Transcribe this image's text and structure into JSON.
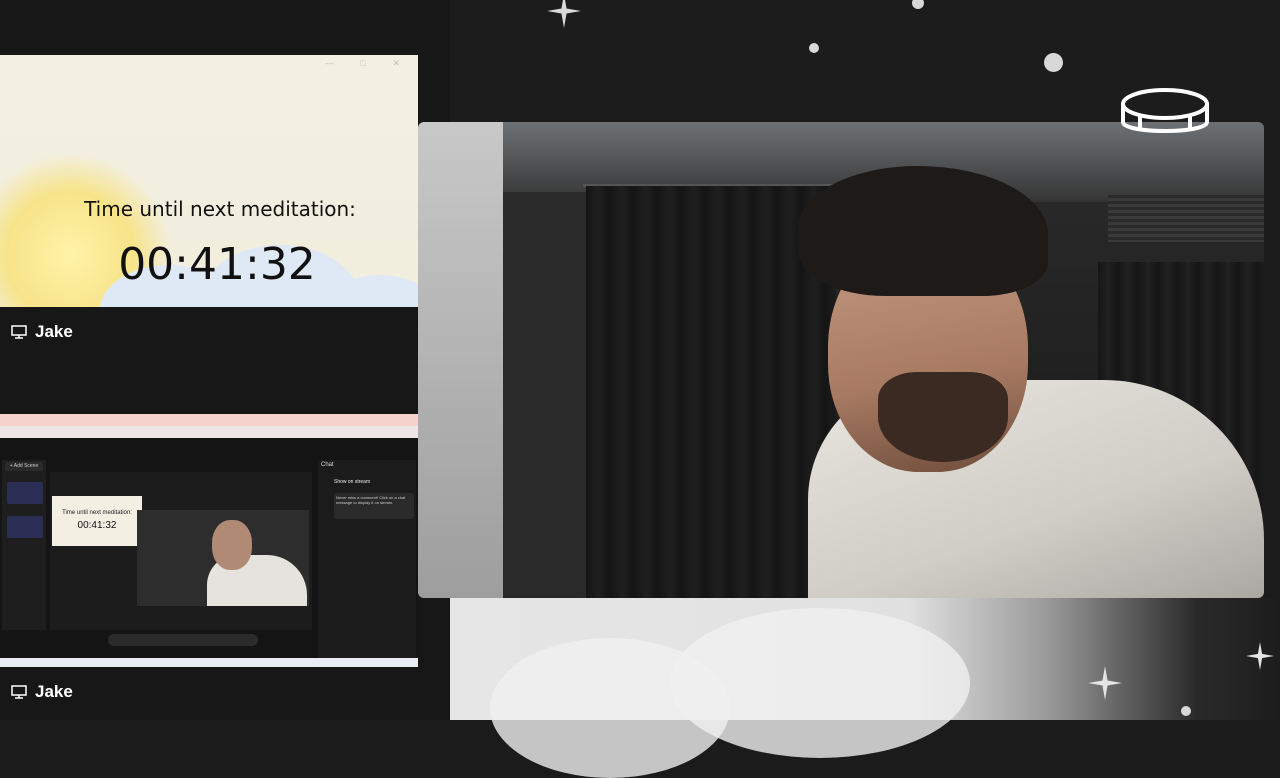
{
  "left_panel": {
    "top_tile": {
      "label": "Time until next meditation:",
      "countdown": "00:41:32",
      "window_controls": "— □ ✕"
    },
    "top_tile_name": "Jake",
    "bottom_tile": {
      "add_scene": "+ Add Scene",
      "mini_label": "Time until next meditation:",
      "mini_countdown": "00:41:32",
      "chat_title": "Chat",
      "chat_show": "Show on stream",
      "chat_bubble": "Never miss a comment! Click on a chat message to display it on stream."
    },
    "bottom_tile_name": "Jake"
  },
  "icons": {
    "screen_share": "monitor-icon",
    "logo": "ring-logo-icon",
    "sparkle": "sparkle-star-icon"
  },
  "colors": {
    "background": "#1c1c1c",
    "tile_bg": "#f3efe3",
    "text_dark": "#111111"
  }
}
